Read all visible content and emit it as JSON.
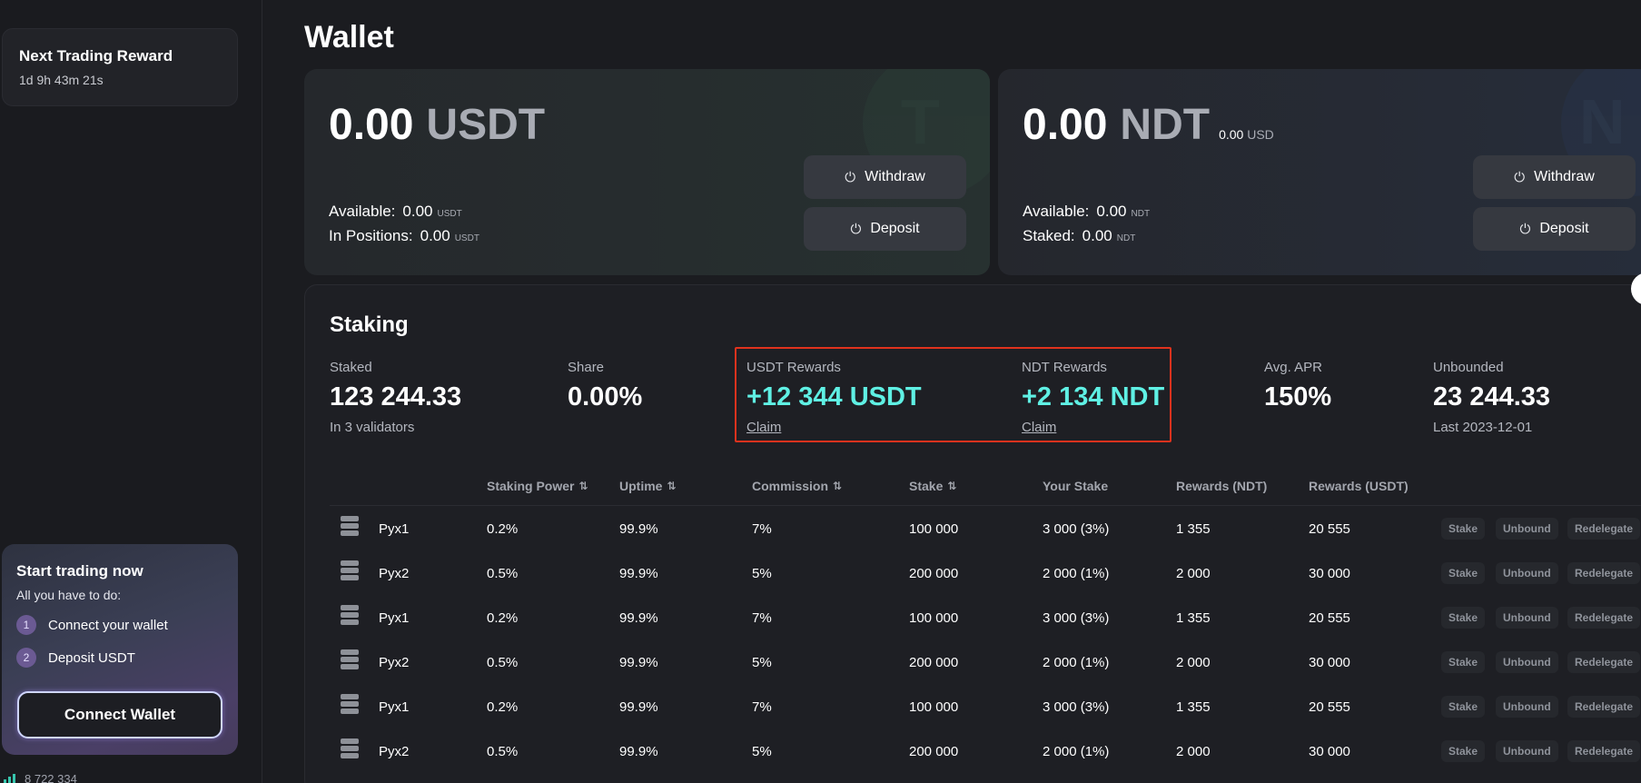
{
  "sidebar": {
    "reward_card": {
      "title": "Next Trading Reward",
      "timer": "1d 9h 43m 21s"
    },
    "start_card": {
      "title": "Start trading now",
      "subtitle": "All you have to do:",
      "steps": [
        {
          "num": "1",
          "label": "Connect your wallet"
        },
        {
          "num": "2",
          "label": "Deposit USDT"
        }
      ],
      "button": "Connect Wallet"
    },
    "bottom_stat": "8 722 334"
  },
  "page": {
    "title": "Wallet"
  },
  "wallets": {
    "usdt": {
      "amount": "0.00",
      "currency": "USDT",
      "rows": [
        {
          "label": "Available:",
          "value": "0.00",
          "unit": "USDT"
        },
        {
          "label": "In Positions:",
          "value": "0.00",
          "unit": "USDT"
        }
      ],
      "withdraw": "Withdraw",
      "deposit": "Deposit"
    },
    "ndt": {
      "amount": "0.00",
      "currency": "NDT",
      "usd_value": "0.00",
      "usd_label": "USD",
      "rows": [
        {
          "label": "Available:",
          "value": "0.00",
          "unit": "NDT"
        },
        {
          "label": "Staked:",
          "value": "0.00",
          "unit": "NDT"
        }
      ],
      "withdraw": "Withdraw",
      "deposit": "Deposit"
    }
  },
  "staking": {
    "title": "Staking",
    "stats": {
      "staked": {
        "label": "Staked",
        "value": "123 244.33",
        "sub": "In 3 validators"
      },
      "share": {
        "label": "Share",
        "value": "0.00%"
      },
      "usdt_rewards": {
        "label": "USDT Rewards",
        "value": "+12 344 USDT",
        "link": "Claim"
      },
      "ndt_rewards": {
        "label": "NDT Rewards",
        "value": "+2 134 NDT",
        "link": "Claim"
      },
      "apr": {
        "label": "Avg. APR",
        "value": "150%"
      },
      "unbounded": {
        "label": "Unbounded",
        "value": "23 244.33",
        "sub": "Last 2023-12-01"
      }
    },
    "columns": [
      "Staking Power",
      "Uptime",
      "Commission",
      "Stake",
      "Your Stake",
      "Rewards (NDT)",
      "Rewards (USDT)"
    ],
    "sort_glyph": "⇅",
    "actions": [
      "Stake",
      "Unbound",
      "Redelegate"
    ],
    "rows": [
      {
        "name": "Pyx1",
        "power": "0.2%",
        "uptime": "99.9%",
        "commission": "7%",
        "stake": "100 000",
        "your_stake": "3 000 (3%)",
        "rew_ndt": "1 355",
        "rew_usdt": "20 555"
      },
      {
        "name": "Pyx2",
        "power": "0.5%",
        "uptime": "99.9%",
        "commission": "5%",
        "stake": "200 000",
        "your_stake": "2 000 (1%)",
        "rew_ndt": "2 000",
        "rew_usdt": "30 000"
      },
      {
        "name": "Pyx1",
        "power": "0.2%",
        "uptime": "99.9%",
        "commission": "7%",
        "stake": "100 000",
        "your_stake": "3 000 (3%)",
        "rew_ndt": "1 355",
        "rew_usdt": "20 555"
      },
      {
        "name": "Pyx2",
        "power": "0.5%",
        "uptime": "99.9%",
        "commission": "5%",
        "stake": "200 000",
        "your_stake": "2 000 (1%)",
        "rew_ndt": "2 000",
        "rew_usdt": "30 000"
      },
      {
        "name": "Pyx1",
        "power": "0.2%",
        "uptime": "99.9%",
        "commission": "7%",
        "stake": "100 000",
        "your_stake": "3 000 (3%)",
        "rew_ndt": "1 355",
        "rew_usdt": "20 555"
      },
      {
        "name": "Pyx2",
        "power": "0.5%",
        "uptime": "99.9%",
        "commission": "5%",
        "stake": "200 000",
        "your_stake": "2 000 (1%)",
        "rew_ndt": "2 000",
        "rew_usdt": "30 000"
      }
    ]
  },
  "colors": {
    "accent_cyan": "#5ff0e4",
    "highlight_red": "#e0321d",
    "background": "#1b1c20"
  }
}
